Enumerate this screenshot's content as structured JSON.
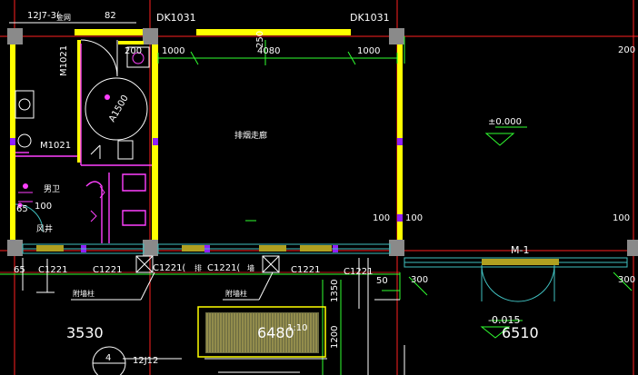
{
  "drawing": {
    "labels": {
      "ref_top_left": "12J7-3(",
      "ref_top_left_note": "金网",
      "ref_top_left_num": "82",
      "door_dk_left": "DK1031",
      "door_dk_right": "DK1031",
      "dim_1000_left": "1000",
      "dim_4080": "4080",
      "dim_1000_right": "1000",
      "dim_250": "250",
      "dim_200_left": "200",
      "dim_200_right": "200",
      "m1021_vertical": "M1021",
      "m1021_horizontal": "M1021",
      "a1500": "A1500",
      "room_center": "排烟走廊",
      "level_mark": "±0.000",
      "dim_100_a": "100",
      "dim_100_b": "100",
      "dim_100_c": "100",
      "dim_100_d": "100",
      "dim_100_e": "100",
      "room_male": "男卫",
      "room_fengjing": "风井",
      "dim_65": "65",
      "door_m1": "M-1",
      "c1221_1": "C1221",
      "c1221_2": "C1221",
      "c1221_3": "C1221(",
      "c1221_4": "C1221(",
      "c1221_5": "C1221",
      "c1221_6": "C1221",
      "paren_1": "排",
      "paren_2": "墙",
      "dim_65_b": "65",
      "fujiang_1": "附墙柱",
      "fujiang_2": "附墙柱",
      "dim_50": "50",
      "dim_300_a": "300",
      "dim_300_b": "300",
      "dim_1350": "1350",
      "dim_1200": "1200",
      "level_015": "-0.015",
      "dim_3530": "3530",
      "dim_6480": "6480",
      "dim_6510": "6510",
      "ratio_10": "1:10",
      "ref_12j12": "12J12",
      "ref_bubble_num": "4"
    }
  }
}
